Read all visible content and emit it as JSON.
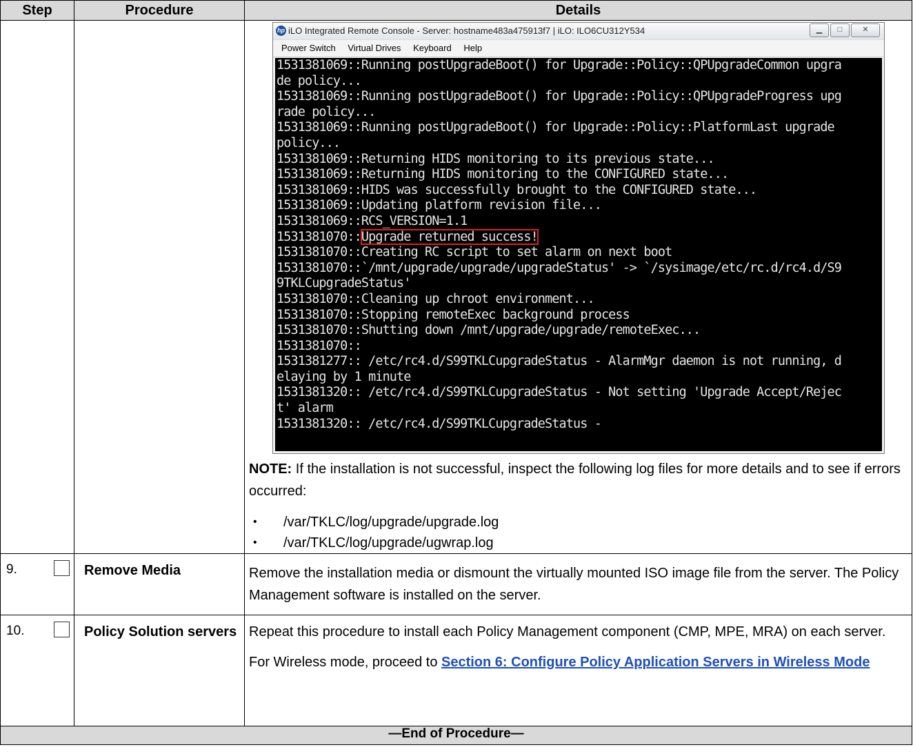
{
  "table": {
    "headers": {
      "step": "Step",
      "procedure": "Procedure",
      "details": "Details"
    }
  },
  "ilo_window": {
    "title": "iLO Integrated Remote Console - Server: hostname483a475913f7 | iLO: ILO6CU312Y534",
    "menu": [
      "Power Switch",
      "Virtual Drives",
      "Keyboard",
      "Help"
    ],
    "console_lines": [
      "1531381069::Running postUpgradeBoot() for Upgrade::Policy::QPUpgradeCommon upgra",
      "de policy...",
      "1531381069::Running postUpgradeBoot() for Upgrade::Policy::QPUpgradeProgress upg",
      "rade policy...",
      "1531381069::Running postUpgradeBoot() for Upgrade::Policy::PlatformLast upgrade",
      "policy...",
      "1531381069::Returning HIDS monitoring to its previous state...",
      "1531381069::Returning HIDS monitoring to the CONFIGURED state...",
      "1531381069::HIDS was successfully brought to the CONFIGURED state...",
      "1531381069::Updating platform revision file...",
      "1531381069::RCS_VERSION=1.1",
      "1531381070::Upgrade returned success!",
      "1531381070::Creating RC script to set alarm on next boot",
      "1531381070::`/mnt/upgrade/upgrade/upgradeStatus' -> `/sysimage/etc/rc.d/rc4.d/S9",
      "9TKLCupgradeStatus'",
      "1531381070::Cleaning up chroot environment...",
      "1531381070::Stopping remoteExec background process",
      "1531381070::Shutting down /mnt/upgrade/upgrade/remoteExec...",
      "1531381070::",
      "1531381277:: /etc/rc4.d/S99TKLCupgradeStatus - AlarmMgr daemon is not running, d",
      "elaying by 1 minute",
      "1531381320:: /etc/rc4.d/S99TKLCupgradeStatus - Not setting 'Upgrade Accept/Rejec",
      "t' alarm",
      "1531381320:: /etc/rc4.d/S99TKLCupgradeStatus -"
    ],
    "highlight": {
      "prefix": "1531381070::",
      "text": "Upgrade returned success!"
    }
  },
  "note": {
    "label": "NOTE:",
    "text": " If the installation is not successful, inspect the following log files for more details and to see if errors occurred:",
    "files": [
      "/var/TKLC/log/upgrade/upgrade.log",
      "/var/TKLC/log/upgrade/ugwrap.log"
    ]
  },
  "steps": [
    {
      "number": "9.",
      "procedure": "Remove Media",
      "details": "Remove the installation media or dismount the virtually mounted ISO image file from the server. The Policy Management software is installed on the server."
    },
    {
      "number": "10.",
      "procedure": "Policy Solution servers",
      "details": "Repeat this procedure to install each Policy Management component (CMP, MPE, MRA) on each server.",
      "details2_prefix": "For Wireless mode, proceed to ",
      "details2_link": "Section 6: Configure Policy Application Servers in Wireless Mode"
    }
  ],
  "footer": "—End of Procedure—"
}
